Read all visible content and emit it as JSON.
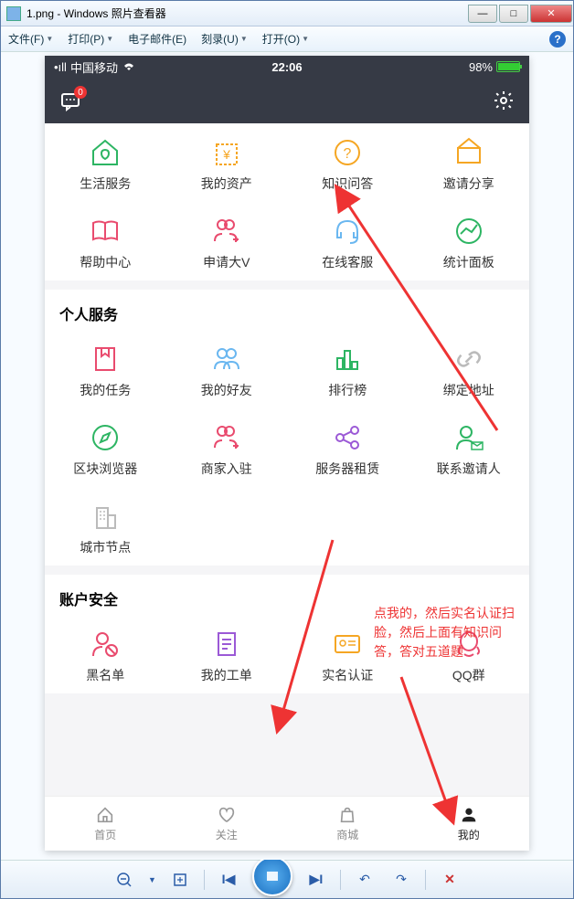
{
  "window": {
    "title": "1.png - Windows 照片查看器"
  },
  "menubar": {
    "file": "文件(F)",
    "print": "打印(P)",
    "email": "电子邮件(E)",
    "burn": "刻录(U)",
    "open": "打开(O)"
  },
  "statusbar": {
    "carrier_prefix": "•ıll",
    "carrier": "中国移动",
    "time": "22:06",
    "battery_pct": "98%"
  },
  "header": {
    "msg_badge": "0"
  },
  "top_grid": {
    "items": [
      {
        "label": "生活服务"
      },
      {
        "label": "我的资产"
      },
      {
        "label": "知识问答"
      },
      {
        "label": "邀请分享"
      },
      {
        "label": "帮助中心"
      },
      {
        "label": "申请大V"
      },
      {
        "label": "在线客服"
      },
      {
        "label": "统计面板"
      }
    ]
  },
  "section_personal": {
    "title": "个人服务",
    "items": [
      {
        "label": "我的任务"
      },
      {
        "label": "我的好友"
      },
      {
        "label": "排行榜"
      },
      {
        "label": "绑定地址"
      },
      {
        "label": "区块浏览器"
      },
      {
        "label": "商家入驻"
      },
      {
        "label": "服务器租赁"
      },
      {
        "label": "联系邀请人"
      },
      {
        "label": "城市节点"
      }
    ]
  },
  "section_account": {
    "title": "账户安全",
    "items": [
      {
        "label": "黑名单"
      },
      {
        "label": "我的工单"
      },
      {
        "label": "实名认证"
      },
      {
        "label": "QQ群"
      }
    ]
  },
  "tabbar": {
    "home": "首页",
    "follow": "关注",
    "mall": "商城",
    "mine": "我的"
  },
  "annotation": {
    "text": "点我的，然后实名认证扫脸，然后上面有知识问答，答对五道题"
  }
}
